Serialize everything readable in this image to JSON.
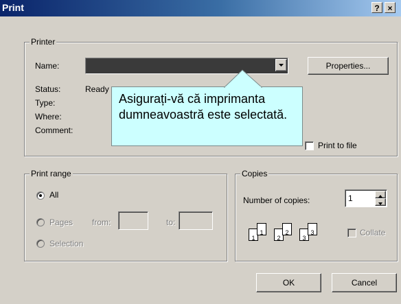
{
  "window": {
    "title": "Print"
  },
  "title_buttons": {
    "help": "?",
    "close": "×"
  },
  "printer": {
    "group_label": "Printer",
    "name_label": "Name:",
    "name_value": "",
    "properties_button": "Properties...",
    "status_label": "Status:",
    "status_value": "Ready",
    "type_label": "Type:",
    "where_label": "Where:",
    "comment_label": "Comment:",
    "print_to_file": "Print to file"
  },
  "callout": {
    "text": "Asigurați-vă că imprimanta dumneavoastră este selectată."
  },
  "print_range": {
    "group_label": "Print range",
    "all": "All",
    "pages": "Pages",
    "from": "from:",
    "to": "to:",
    "selection": "Selection",
    "selected": "All"
  },
  "copies": {
    "group_label": "Copies",
    "number_label": "Number of copies:",
    "number_value": "1",
    "collate": "Collate",
    "page_icons": [
      "1",
      "1",
      "2",
      "2",
      "3",
      "3"
    ]
  },
  "footer": {
    "ok": "OK",
    "cancel": "Cancel"
  }
}
